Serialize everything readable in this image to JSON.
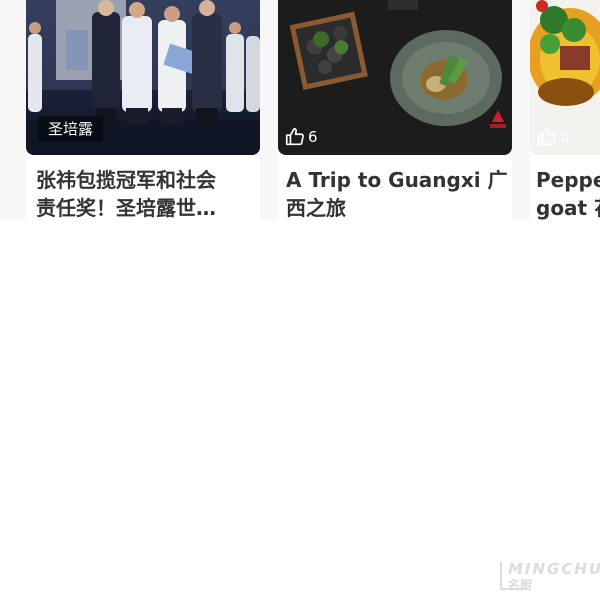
{
  "cards": [
    {
      "source_tag": "圣培露",
      "title": "张祎包揽冠军和社会\n责任奖！圣培露世…"
    },
    {
      "likes": "6",
      "title": "A Trip to Guangxi 广\n西之旅"
    },
    {
      "likes": "0",
      "title": "Peppe\ngoat 花"
    }
  ],
  "icons": {
    "like": "thumbs-up-icon"
  },
  "colors": {
    "title_text": "#333333",
    "strip_background": "#f7f7f7",
    "watermark": "#dcdcdc"
  },
  "watermark": {
    "en": "MINGCHU",
    "zh": "名厨"
  }
}
